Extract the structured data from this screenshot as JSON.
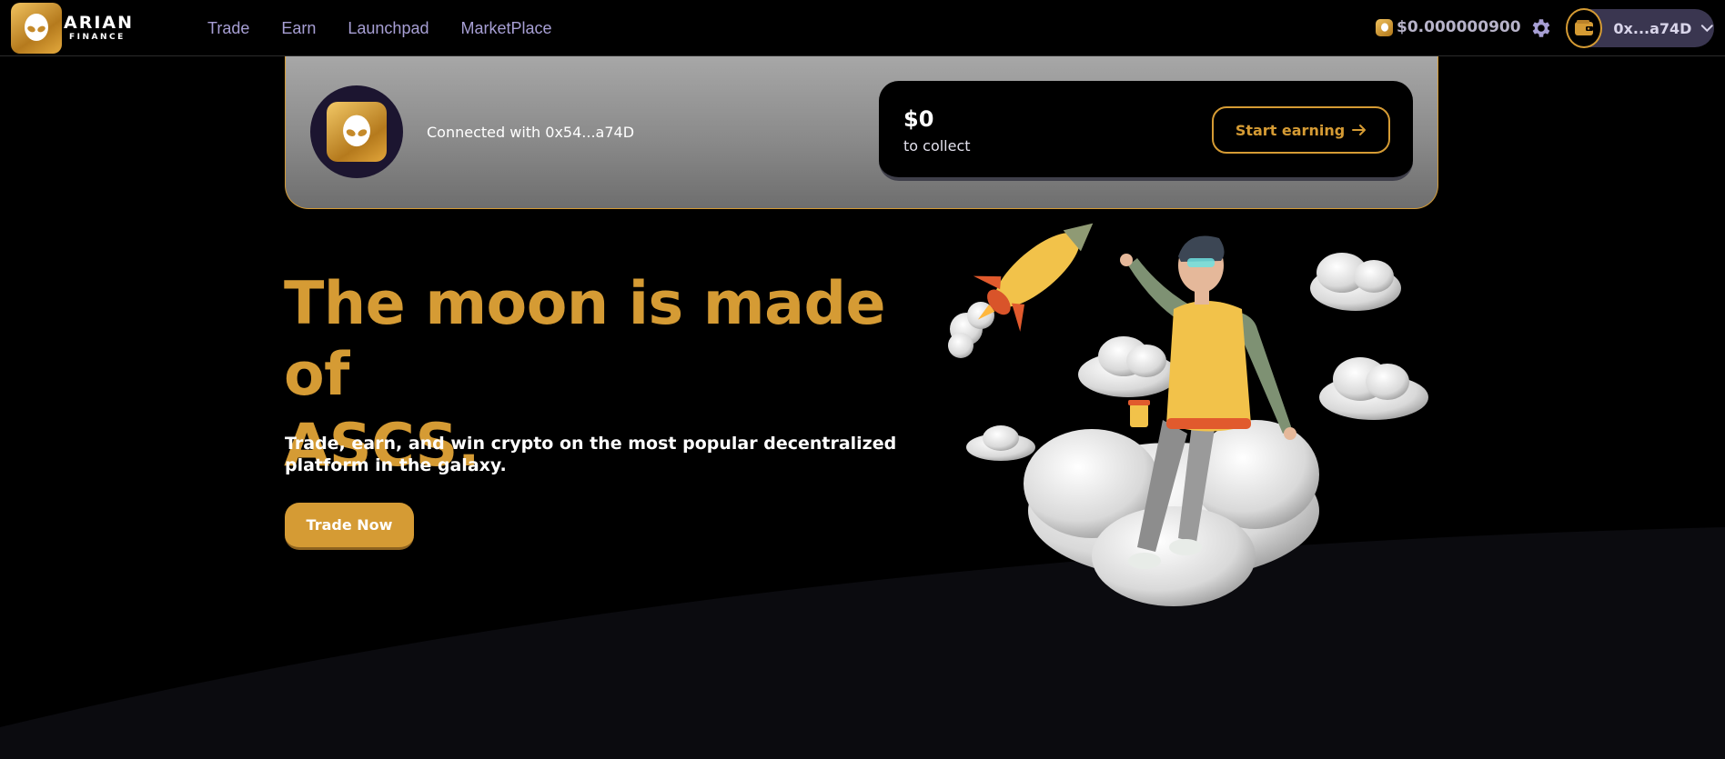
{
  "nav": {
    "logo_name": "ARIAN",
    "logo_sub": "FINANCE",
    "links": [
      "Trade",
      "Earn",
      "Launchpad",
      "MarketPlace"
    ],
    "price": "$0.000000900",
    "wallet_address": "0x...a74D",
    "accent": "#D59B34"
  },
  "banner": {
    "connected_text": "Connected with 0x54...a74D",
    "collect_amount": "$0",
    "collect_label": "to collect",
    "start_button": "Start earning"
  },
  "hero": {
    "title_line1": "The moon is made of",
    "title_line2": "ASCS.",
    "subtitle_line1": "Trade, earn, and win crypto on the most popular decentralized",
    "subtitle_line2": "platform in the galaxy.",
    "button": "Trade Now"
  },
  "icons": [
    "alien-logo-icon",
    "coin-icon",
    "gear-icon",
    "wallet-icon",
    "chevron-down-icon",
    "arrow-right-icon"
  ]
}
